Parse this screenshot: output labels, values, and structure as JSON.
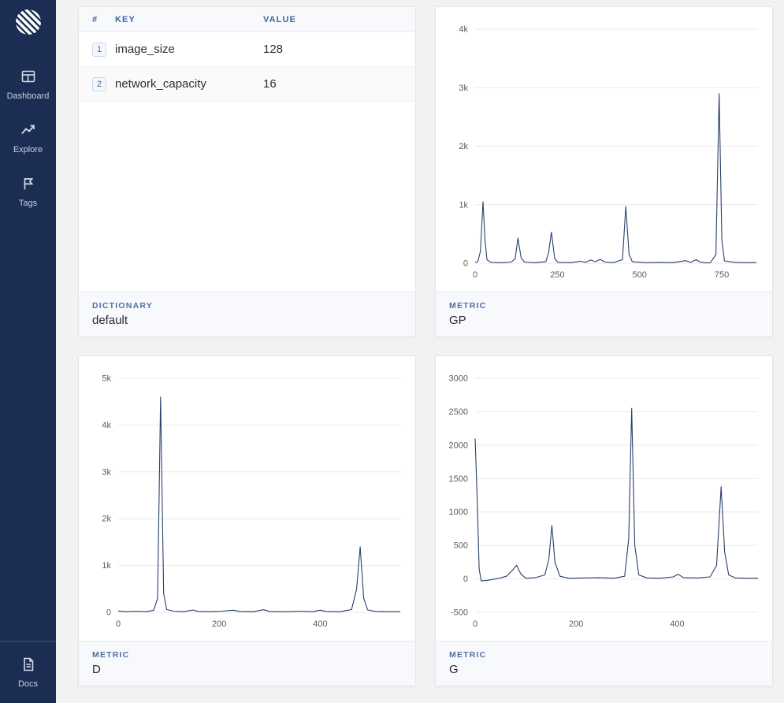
{
  "colors": {
    "sidebar_bg": "#1b2d52",
    "page_bg": "#f2f2f2",
    "accent_blue": "#3c6aa6",
    "footer_label": "#51719f",
    "line": "#2a3f6e",
    "gridline": "#e9e9e9",
    "tick_text": "#5b5b5b",
    "footer_bg": "#f7f9fd"
  },
  "sidebar": {
    "items": [
      {
        "label": "Dashboard",
        "icon": "dashboard-icon"
      },
      {
        "label": "Explore",
        "icon": "explore-icon"
      },
      {
        "label": "Tags",
        "icon": "tags-icon"
      }
    ],
    "bottom_items": [
      {
        "label": "Docs",
        "icon": "docs-icon"
      }
    ]
  },
  "cards": {
    "dictionary": {
      "table": {
        "headers": [
          "#",
          "KEY",
          "VALUE"
        ],
        "rows": [
          {
            "index": "1",
            "key": "image_size",
            "value": "128"
          },
          {
            "index": "2",
            "key": "network_capacity",
            "value": "16"
          }
        ]
      },
      "footer": {
        "label": "DICTIONARY",
        "value": "default"
      }
    }
  },
  "chart_data": [
    {
      "type": "line",
      "name": "GP",
      "footer_label": "METRIC",
      "xlim": [
        0,
        860
      ],
      "ylim": [
        0,
        4000
      ],
      "yticks": [
        0,
        1000,
        2000,
        3000,
        4000
      ],
      "ytick_labels": [
        "0",
        "1k",
        "2k",
        "3k",
        "4k"
      ],
      "xticks": [
        0,
        250,
        500,
        750
      ],
      "xtick_labels": [
        "0",
        "250",
        "500",
        "750"
      ],
      "grid": "horizontal",
      "points": [
        [
          0,
          15
        ],
        [
          8,
          25
        ],
        [
          16,
          200
        ],
        [
          24,
          1050
        ],
        [
          30,
          400
        ],
        [
          36,
          60
        ],
        [
          48,
          15
        ],
        [
          80,
          10
        ],
        [
          110,
          20
        ],
        [
          122,
          80
        ],
        [
          130,
          430
        ],
        [
          140,
          90
        ],
        [
          150,
          20
        ],
        [
          180,
          10
        ],
        [
          215,
          25
        ],
        [
          224,
          200
        ],
        [
          232,
          530
        ],
        [
          242,
          80
        ],
        [
          252,
          15
        ],
        [
          290,
          10
        ],
        [
          320,
          35
        ],
        [
          335,
          15
        ],
        [
          352,
          55
        ],
        [
          365,
          25
        ],
        [
          380,
          65
        ],
        [
          395,
          20
        ],
        [
          420,
          10
        ],
        [
          448,
          60
        ],
        [
          458,
          970
        ],
        [
          468,
          150
        ],
        [
          478,
          25
        ],
        [
          520,
          10
        ],
        [
          560,
          15
        ],
        [
          600,
          10
        ],
        [
          640,
          45
        ],
        [
          655,
          15
        ],
        [
          672,
          60
        ],
        [
          684,
          20
        ],
        [
          700,
          5
        ],
        [
          715,
          10
        ],
        [
          732,
          150
        ],
        [
          742,
          2900
        ],
        [
          750,
          400
        ],
        [
          758,
          40
        ],
        [
          790,
          15
        ],
        [
          820,
          10
        ],
        [
          855,
          12
        ]
      ]
    },
    {
      "type": "line",
      "name": "D",
      "footer_label": "METRIC",
      "xlim": [
        0,
        560
      ],
      "ylim": [
        0,
        5000
      ],
      "yticks": [
        0,
        1000,
        2000,
        3000,
        4000,
        5000
      ],
      "ytick_labels": [
        "0",
        "1k",
        "2k",
        "3k",
        "4k",
        "5k"
      ],
      "xticks": [
        0,
        200,
        400
      ],
      "xtick_labels": [
        "0",
        "200",
        "400"
      ],
      "grid": "horizontal",
      "points": [
        [
          0,
          30
        ],
        [
          15,
          15
        ],
        [
          35,
          25
        ],
        [
          55,
          15
        ],
        [
          70,
          40
        ],
        [
          78,
          300
        ],
        [
          84,
          4600
        ],
        [
          90,
          400
        ],
        [
          96,
          60
        ],
        [
          110,
          25
        ],
        [
          130,
          15
        ],
        [
          148,
          50
        ],
        [
          158,
          20
        ],
        [
          180,
          15
        ],
        [
          205,
          25
        ],
        [
          228,
          45
        ],
        [
          240,
          20
        ],
        [
          268,
          15
        ],
        [
          288,
          55
        ],
        [
          300,
          20
        ],
        [
          330,
          15
        ],
        [
          360,
          25
        ],
        [
          385,
          15
        ],
        [
          400,
          45
        ],
        [
          412,
          20
        ],
        [
          440,
          15
        ],
        [
          462,
          60
        ],
        [
          472,
          500
        ],
        [
          479,
          1400
        ],
        [
          486,
          300
        ],
        [
          494,
          50
        ],
        [
          510,
          20
        ],
        [
          535,
          15
        ],
        [
          558,
          18
        ]
      ]
    },
    {
      "type": "line",
      "name": "G",
      "footer_label": "METRIC",
      "xlim": [
        0,
        560
      ],
      "ylim": [
        -500,
        3000
      ],
      "yticks": [
        -500,
        0,
        500,
        1000,
        1500,
        2000,
        2500,
        3000
      ],
      "ytick_labels": [
        "-500",
        "0",
        "500",
        "1000",
        "1500",
        "2000",
        "2500",
        "3000"
      ],
      "xticks": [
        0,
        200,
        400
      ],
      "xtick_labels": [
        "0",
        "200",
        "400"
      ],
      "grid": "horizontal",
      "points": [
        [
          0,
          2100
        ],
        [
          4,
          1200
        ],
        [
          8,
          150
        ],
        [
          12,
          -30
        ],
        [
          25,
          -20
        ],
        [
          45,
          5
        ],
        [
          62,
          40
        ],
        [
          74,
          130
        ],
        [
          82,
          205
        ],
        [
          90,
          80
        ],
        [
          100,
          10
        ],
        [
          120,
          20
        ],
        [
          138,
          60
        ],
        [
          146,
          300
        ],
        [
          152,
          800
        ],
        [
          158,
          250
        ],
        [
          168,
          40
        ],
        [
          185,
          10
        ],
        [
          215,
          15
        ],
        [
          245,
          20
        ],
        [
          275,
          10
        ],
        [
          296,
          40
        ],
        [
          304,
          600
        ],
        [
          310,
          2550
        ],
        [
          316,
          500
        ],
        [
          324,
          60
        ],
        [
          340,
          15
        ],
        [
          365,
          10
        ],
        [
          392,
          30
        ],
        [
          402,
          70
        ],
        [
          412,
          20
        ],
        [
          440,
          15
        ],
        [
          465,
          30
        ],
        [
          478,
          200
        ],
        [
          487,
          1380
        ],
        [
          494,
          400
        ],
        [
          502,
          60
        ],
        [
          515,
          15
        ],
        [
          540,
          10
        ],
        [
          560,
          12
        ]
      ]
    }
  ]
}
